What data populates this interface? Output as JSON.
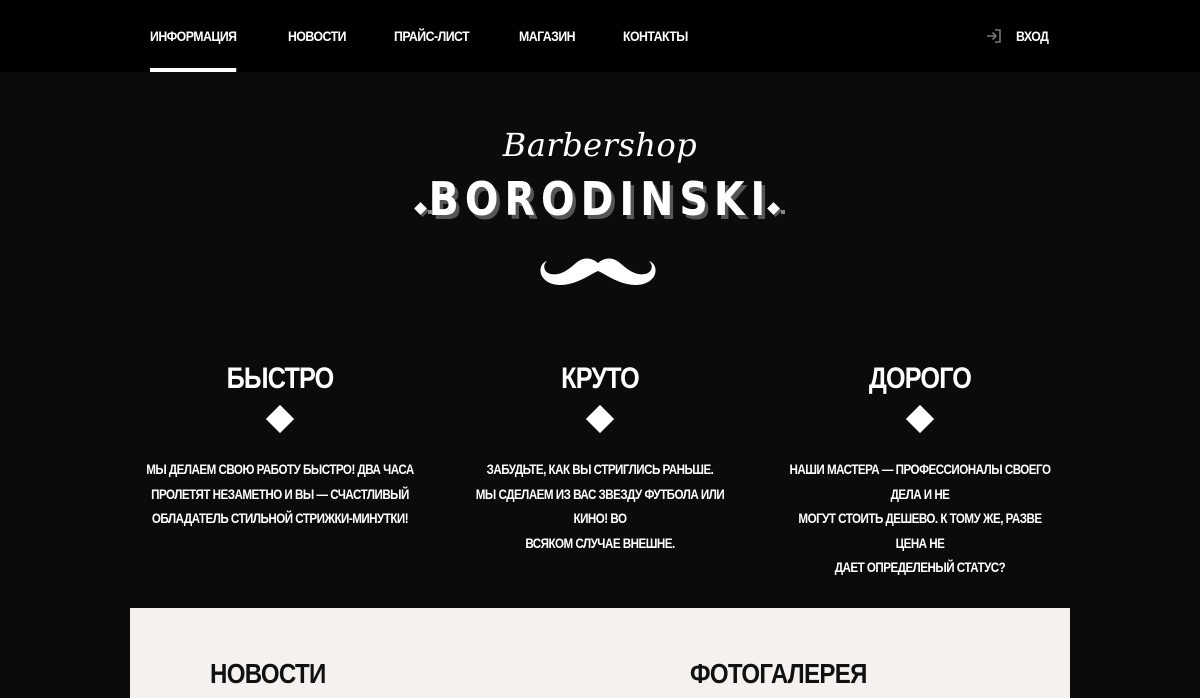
{
  "nav": {
    "items": [
      {
        "label": "ИНФОРМАЦИЯ",
        "active": true
      },
      {
        "label": "НОВОСТИ",
        "active": false
      },
      {
        "label": "ПРАЙС-ЛИСТ",
        "active": false
      },
      {
        "label": "МАГАЗИН",
        "active": false
      },
      {
        "label": "КОНТАКТЫ",
        "active": false
      }
    ],
    "login_label": "ВХОД",
    "login_icon": "login-arrow-icon"
  },
  "logo": {
    "script_text": "Barbershop",
    "name": "BORODINSKI",
    "icon": "mustache-icon"
  },
  "features": [
    {
      "title": "БЫСТРО",
      "text": "МЫ ДЕЛАЕМ СВОЮ РАБОТУ БЫСТРО! ДВА ЧАСА\nПРОЛЕТЯТ НЕЗАМЕТНО И ВЫ — СЧАСТЛИВЫЙ\nОБЛАДАТЕЛЬ СТИЛЬНОЙ СТРИЖКИ-МИНУТКИ!"
    },
    {
      "title": "КРУТО",
      "text": "ЗАБУДЬТЕ, КАК ВЫ СТРИГЛИСЬ РАНЬШЕ.\nМЫ СДЕЛАЕМ ИЗ ВАС ЗВЕЗДУ ФУТБОЛА ИЛИ КИНО! ВО\nВСЯКОМ СЛУЧАЕ ВНЕШНЕ."
    },
    {
      "title": "ДОРОГО",
      "text": "НАШИ МАСТЕРА — ПРОФЕССИОНАЛЫ СВОЕГО ДЕЛА И НЕ\nМОГУТ СТОИТЬ ДЕШЕВО. К ТОМУ ЖЕ, РАЗВЕ ЦЕНА НЕ\nДАЕТ ОПРЕДЕЛЕНЫЙ СТАТУС?"
    }
  ],
  "panel": {
    "news_heading": "НОВОСТИ",
    "gallery_heading": "ФОТОГАЛЕРЕЯ"
  },
  "colors": {
    "page_bg": "#0b0b0b",
    "header_bg": "#000000",
    "text": "#ffffff",
    "panel_bg": "#f4f1ee"
  }
}
